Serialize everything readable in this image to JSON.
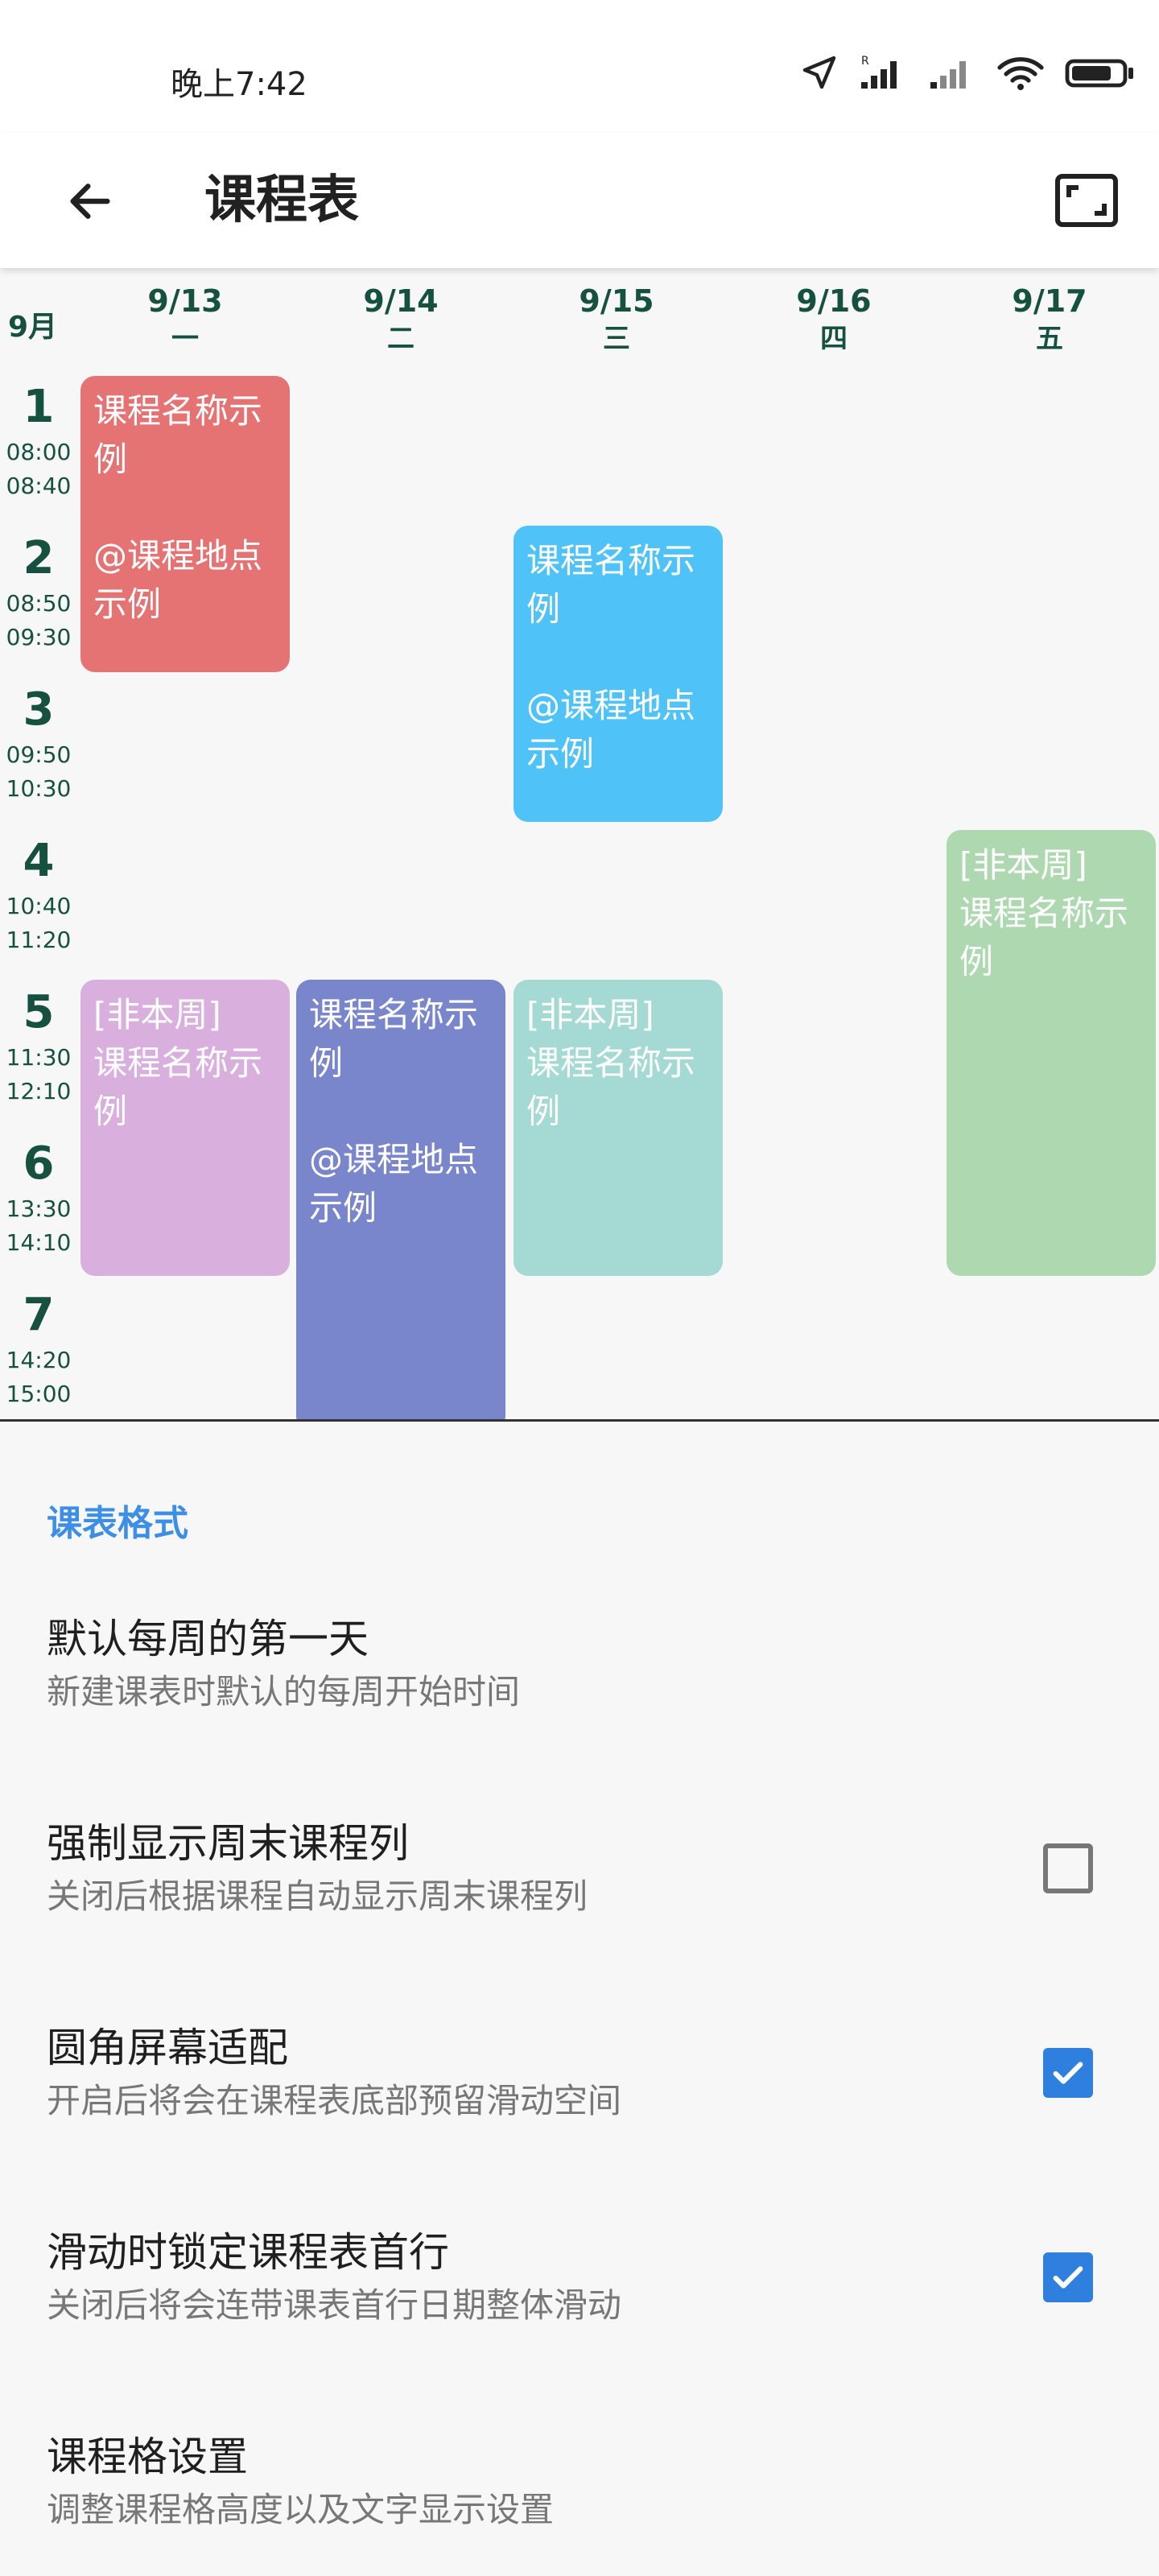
{
  "status_bar": {
    "time": "晚上7:42"
  },
  "app_bar": {
    "title": "课程表"
  },
  "timetable": {
    "month": "9月",
    "days": [
      {
        "date": "9/13",
        "weekday": "一"
      },
      {
        "date": "9/14",
        "weekday": "二"
      },
      {
        "date": "9/15",
        "weekday": "三"
      },
      {
        "date": "9/16",
        "weekday": "四"
      },
      {
        "date": "9/17",
        "weekday": "五"
      }
    ],
    "periods": [
      {
        "num": "1",
        "start": "08:00",
        "end": "08:40"
      },
      {
        "num": "2",
        "start": "08:50",
        "end": "09:30"
      },
      {
        "num": "3",
        "start": "09:50",
        "end": "10:30"
      },
      {
        "num": "4",
        "start": "10:40",
        "end": "11:20"
      },
      {
        "num": "5",
        "start": "11:30",
        "end": "12:10"
      },
      {
        "num": "6",
        "start": "13:30",
        "end": "14:10"
      },
      {
        "num": "7",
        "start": "14:20",
        "end": "15:00"
      }
    ],
    "courses": [
      {
        "line1": "课程名称示例",
        "line2": "@课程地点示例",
        "color": "#e57373"
      },
      {
        "line1": "课程名称示例",
        "line2": "@课程地点示例",
        "color": "#4fc3f7"
      },
      {
        "line1": "[非本周]",
        "line2": "课程名称示例",
        "color": "#aed9b0"
      },
      {
        "line1": "[非本周]",
        "line2": "课程名称示例",
        "color": "#d9afdd"
      },
      {
        "line1": "课程名称示例",
        "line2": "@课程地点示例",
        "color": "#7986cb"
      },
      {
        "line1": "[非本周]",
        "line2": "课程名称示例",
        "color": "#a4d9d4"
      }
    ]
  },
  "settings": {
    "section_title": "课表格式",
    "items": [
      {
        "title": "默认每周的第一天",
        "subtitle": "新建课表时默认的每周开始时间"
      },
      {
        "title": "强制显示周末课程列",
        "subtitle": "关闭后根据课程自动显示周末课程列",
        "checked": false
      },
      {
        "title": "圆角屏幕适配",
        "subtitle": "开启后将会在课程表底部预留滑动空间",
        "checked": true
      },
      {
        "title": "滑动时锁定课程表首行",
        "subtitle": "关闭后将会连带课表首行日期整体滑动",
        "checked": true
      },
      {
        "title": "课程格设置",
        "subtitle": "调整课程格高度以及文字显示设置"
      }
    ]
  }
}
